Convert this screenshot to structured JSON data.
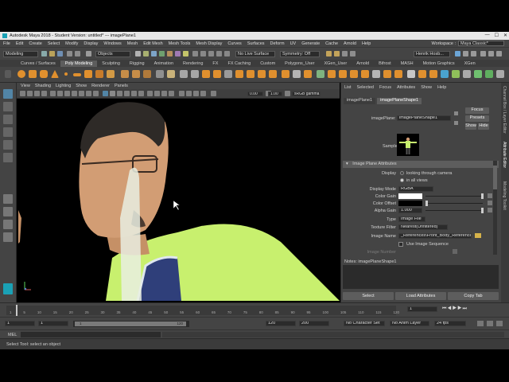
{
  "window": {
    "title": "Autodesk Maya 2018 - Student Version: untitled*  ---  imagePlane1"
  },
  "menubar": {
    "items": [
      "File",
      "Edit",
      "Create",
      "Select",
      "Modify",
      "Display",
      "Windows",
      "Mesh",
      "Edit Mesh",
      "Mesh Tools",
      "Mesh Display",
      "Curves",
      "Surfaces",
      "Deform",
      "UV",
      "Generate",
      "Cache",
      "Arnold",
      "Help"
    ],
    "workspace_label": "Workspace :",
    "workspace_value": "Maya Classic*"
  },
  "statusline": {
    "mode": "Modeling",
    "objects": "Objects",
    "live_surface": "No Live Surface",
    "symmetry": "Symmetry: Off",
    "user": "Henrik Hosb..."
  },
  "shelf": {
    "tabs": [
      "Curves / Surfaces",
      "Poly Modeling",
      "Sculpting",
      "Rigging",
      "Animation",
      "Rendering",
      "FX",
      "FX Caching",
      "Custom",
      "Polygons_User",
      "XGen_User",
      "Arnold",
      "Bifrost",
      "MASH",
      "Motion Graphics",
      "XGen"
    ],
    "active_tab": "Poly Modeling"
  },
  "viewport": {
    "menu": [
      "View",
      "Shading",
      "Lighting",
      "Show",
      "Renderer",
      "Panels"
    ],
    "field_a": "0.00",
    "field_b": "1.00",
    "colorspace": "sRGB gamma"
  },
  "attribute_editor": {
    "menu": [
      "List",
      "Selected",
      "Focus",
      "Attributes",
      "Show",
      "Help"
    ],
    "tabs": [
      "imagePlane1",
      "imagePlaneShape1"
    ],
    "active_tab": "imagePlaneShape1",
    "imageplane_label": "imagePlane:",
    "imageplane_value": "imagePlaneShape1",
    "focus_label": "Focus",
    "presets_label": "Presets",
    "show_label": "Show",
    "hide_label": "Hide",
    "sample_label": "Sample",
    "section_title": "Image Plane Attributes",
    "display_label": "Display",
    "display_opt1": "looking through camera",
    "display_opt2": "in all views",
    "display_mode_label": "Display Mode",
    "display_mode_value": "RGBA",
    "color_gain_label": "Color Gain",
    "color_offset_label": "Color Offset",
    "alpha_gain_label": "Alpha Gain",
    "alpha_gain_value": "1.000",
    "type_label": "Type",
    "type_value": "Image File",
    "texture_filter_label": "Texture Filter",
    "texture_filter_value": "Nearest(Unfiltered)",
    "image_name_label": "Image Name",
    "image_name_value": "_References\\Front_Body_Reference.jpg",
    "use_sequence_label": "Use Image Sequence",
    "image_number_label": "Image Number",
    "notes_label": "Notes: imagePlaneShape1",
    "select_label": "Select",
    "load_attributes_label": "Load Attributes",
    "copy_tab_label": "Copy Tab"
  },
  "right_strip": {
    "labels": [
      "Channel Box / Layer Editor",
      "Attribute Editor",
      "Modeling Toolkit"
    ]
  },
  "timeline": {
    "ticks": [
      "1",
      "5",
      "10",
      "15",
      "20",
      "25",
      "30",
      "35",
      "40",
      "45",
      "50",
      "55",
      "60",
      "65",
      "70",
      "75",
      "80",
      "85",
      "90",
      "95",
      "100",
      "105",
      "110",
      "115",
      "120"
    ],
    "current_frame": "1"
  },
  "range": {
    "start": "1",
    "playback_start": "1",
    "slider_start": "1",
    "slider_end": "120",
    "playback_end": "120",
    "end": "200",
    "character_set": "No Character Set",
    "anim_layer": "No Anim Layer",
    "fps": "24 fps"
  },
  "mel": {
    "label": "MEL"
  },
  "help_line": {
    "text": "Select Tool: select an object"
  },
  "colors": {
    "panel": "#444444",
    "accent_blue": "#5285a6",
    "shirt": "#c8f06e",
    "field": "#2b2b2b"
  }
}
